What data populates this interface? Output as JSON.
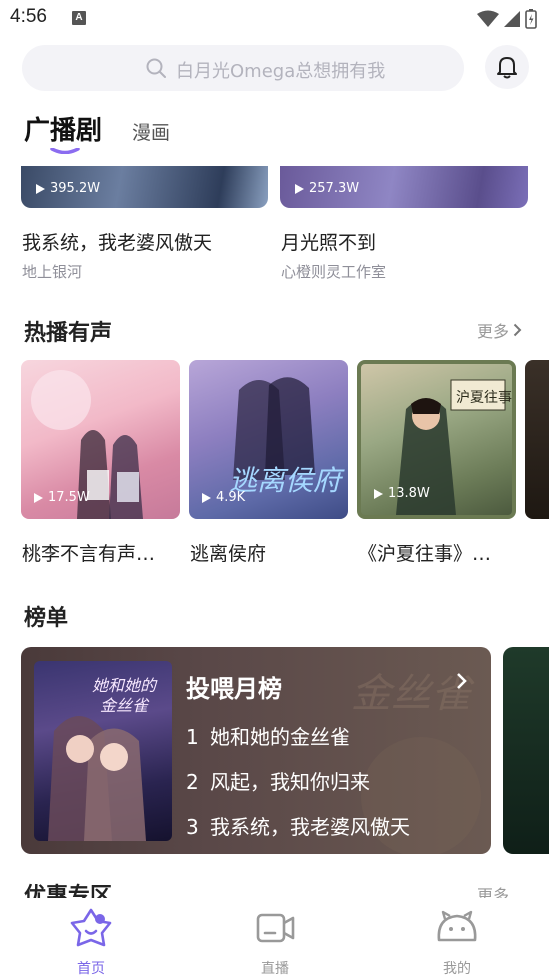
{
  "status_bar": {
    "time": "4:56",
    "a_label": "A"
  },
  "search": {
    "placeholder": "白月光Omega总想拥有我"
  },
  "tabs": {
    "main": "广播剧",
    "secondary": "漫画"
  },
  "top_cards": [
    {
      "plays": "395.2W",
      "title": "我系统，我老婆风傲天",
      "author": "地上银河"
    },
    {
      "plays": "257.3W",
      "title": "月光照不到",
      "author": "心橙则灵工作室"
    }
  ],
  "hot_section": {
    "title": "热播有声",
    "more": "更多",
    "items": [
      {
        "plays": "17.5W",
        "title": "桃李不言有声…"
      },
      {
        "plays": "4.9K",
        "title": "逃离侯府"
      },
      {
        "plays": "13.8W",
        "title": "《沪夏往事》…"
      }
    ]
  },
  "rank_section": {
    "title": "榜单",
    "card_title": "投喂月榜",
    "items": [
      {
        "num": "1",
        "name": "她和她的金丝雀"
      },
      {
        "num": "2",
        "name": "风起，我知你归来"
      },
      {
        "num": "3",
        "name": "我系统，我老婆风傲天"
      }
    ]
  },
  "peek_section": {
    "title": "优惠专区",
    "more": "更多"
  },
  "bottom_nav": [
    {
      "label": "首页",
      "active": true
    },
    {
      "label": "直播",
      "active": false
    },
    {
      "label": "我的",
      "active": false
    }
  ],
  "colors": {
    "accent": "#7a66e8",
    "tab_underline": "#8b6cf0"
  }
}
